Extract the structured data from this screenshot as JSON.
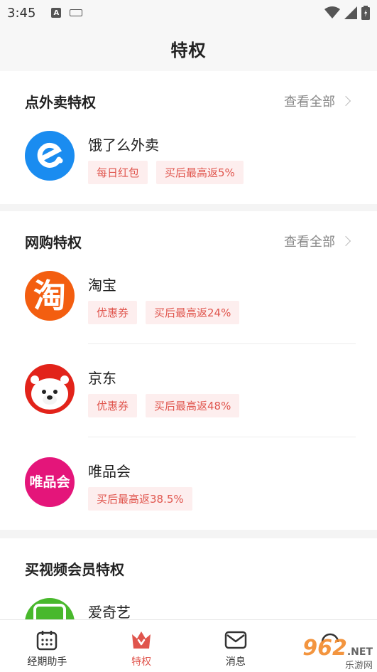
{
  "status": {
    "time": "3:45",
    "a_icon": "A"
  },
  "header": {
    "title": "特权"
  },
  "sections": [
    {
      "title": "点外卖特权",
      "view_all": "查看全部",
      "items": [
        {
          "name": "饿了么外卖",
          "tags": [
            "每日红包",
            "买后最高返5%"
          ],
          "icon": "eleme-logo"
        }
      ]
    },
    {
      "title": "网购特权",
      "view_all": "查看全部",
      "items": [
        {
          "name": "淘宝",
          "tags": [
            "优惠券",
            "买后最高返24%"
          ],
          "icon": "taobao-logo",
          "logo_text": "淘"
        },
        {
          "name": "京东",
          "tags": [
            "优惠券",
            "买后最高返48%"
          ],
          "icon": "jd-logo"
        },
        {
          "name": "唯品会",
          "tags": [
            "买后最高返38.5%"
          ],
          "icon": "vip-logo",
          "logo_text": "唯品会"
        }
      ]
    },
    {
      "title": "买视频会员特权",
      "items": [
        {
          "name": "爱奇艺",
          "icon": "iqiyi-logo"
        }
      ]
    }
  ],
  "tabbar": {
    "tabs": [
      {
        "label": "经期助手",
        "icon": "calendar-icon"
      },
      {
        "label": "特权",
        "icon": "crown-icon",
        "active": true
      },
      {
        "label": "消息",
        "icon": "mail-icon"
      },
      {
        "label": "",
        "icon": "headset-icon"
      }
    ]
  },
  "watermark": {
    "text": "962",
    "suffix": ".NET",
    "sub": "乐游网"
  },
  "colors": {
    "accent": "#e0554d",
    "tag_bg": "#fdeeee",
    "eleme": "#1a8cf0",
    "taobao": "#f35e10",
    "jd": "#e2231a",
    "vip": "#e4157a",
    "iqiyi": "#48b82c"
  }
}
